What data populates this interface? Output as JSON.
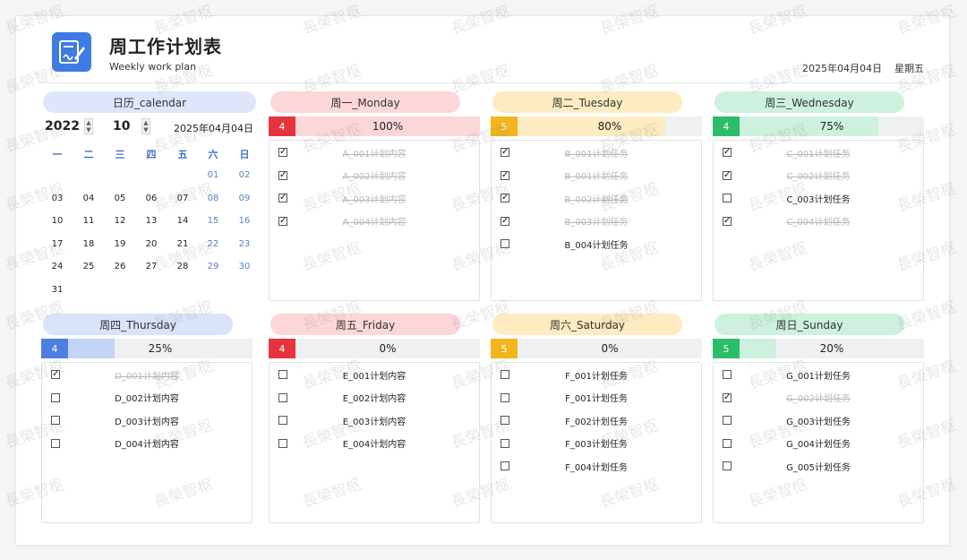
{
  "header": {
    "title": "周工作计划表",
    "subtitle": "Weekly work plan",
    "date": "2025年04月04日",
    "weekday": "星期五"
  },
  "calendar": {
    "title": "日历_calendar",
    "year": "2022",
    "month": "10",
    "date": "2025年04月04日",
    "weekdays": [
      "一",
      "二",
      "三",
      "四",
      "五",
      "六",
      "日"
    ],
    "rows": [
      [
        "",
        "",
        "",
        "",
        "",
        "01",
        "02"
      ],
      [
        "03",
        "04",
        "05",
        "06",
        "07",
        "08",
        "09"
      ],
      [
        "10",
        "11",
        "12",
        "13",
        "14",
        "15",
        "16"
      ],
      [
        "17",
        "18",
        "19",
        "20",
        "21",
        "22",
        "23"
      ],
      [
        "24",
        "25",
        "26",
        "27",
        "28",
        "29",
        "30"
      ],
      [
        "31",
        "",
        "",
        "",
        "",
        "",
        ""
      ]
    ]
  },
  "days": [
    {
      "title": "周一_Monday",
      "count": "4",
      "percent": "100%",
      "fraction": 1.0,
      "pill": "#fcd7d9",
      "num": "#e6343e",
      "fill": "#fcd7d9",
      "tasks": [
        {
          "text": "A_001计划内容",
          "done": true
        },
        {
          "text": "A_002计划内容",
          "done": true
        },
        {
          "text": "A_003计划内容",
          "done": true
        },
        {
          "text": "A_004计划内容",
          "done": true
        }
      ]
    },
    {
      "title": "周二_Tuesday",
      "count": "5",
      "percent": "80%",
      "fraction": 0.8,
      "pill": "#fdebc2",
      "num": "#f2b51d",
      "fill": "#fdebc2",
      "tasks": [
        {
          "text": "B_001计划任务",
          "done": true
        },
        {
          "text": "B_001计划任务",
          "done": true
        },
        {
          "text": "B_002计划任务",
          "done": true
        },
        {
          "text": "B_003计划任务",
          "done": true
        },
        {
          "text": "B_004计划任务",
          "done": false
        }
      ]
    },
    {
      "title": "周三_Wednesday",
      "count": "4",
      "percent": "75%",
      "fraction": 0.75,
      "pill": "#cdf1de",
      "num": "#2bbd6a",
      "fill": "#cdf1de",
      "tasks": [
        {
          "text": "C_001计划任务",
          "done": true
        },
        {
          "text": "C_002计划任务",
          "done": true
        },
        {
          "text": "C_003计划任务",
          "done": false
        },
        {
          "text": "C_004计划任务",
          "done": true
        }
      ]
    },
    {
      "title": "周四_Thursday",
      "count": "4",
      "percent": "25%",
      "fraction": 0.25,
      "pill": "#d9e3fa",
      "num": "#4e7fe0",
      "fill": "#c4d4f7",
      "tasks": [
        {
          "text": "D_001计划内容",
          "done": true
        },
        {
          "text": "D_002计划内容",
          "done": false
        },
        {
          "text": "D_003计划内容",
          "done": false
        },
        {
          "text": "D_004计划内容",
          "done": false
        }
      ]
    },
    {
      "title": "周五_Friday",
      "count": "4",
      "percent": "0%",
      "fraction": 0.0,
      "pill": "#fcd7d9",
      "num": "#e6343e",
      "fill": "#fcd7d9",
      "tasks": [
        {
          "text": "E_001计划内容",
          "done": false
        },
        {
          "text": "E_002计划内容",
          "done": false
        },
        {
          "text": "E_003计划内容",
          "done": false
        },
        {
          "text": "E_004计划内容",
          "done": false
        }
      ]
    },
    {
      "title": "周六_Saturday",
      "count": "5",
      "percent": "0%",
      "fraction": 0.0,
      "pill": "#fdebc2",
      "num": "#f2b51d",
      "fill": "#fdebc2",
      "tasks": [
        {
          "text": "F_001计划任务",
          "done": false
        },
        {
          "text": "F_001计划任务",
          "done": false
        },
        {
          "text": "F_002计划任务",
          "done": false
        },
        {
          "text": "F_003计划任务",
          "done": false
        },
        {
          "text": "F_004计划任务",
          "done": false
        }
      ]
    },
    {
      "title": "周日_Sunday",
      "count": "5",
      "percent": "20%",
      "fraction": 0.2,
      "pill": "#cdf1de",
      "num": "#2bbd6a",
      "fill": "#cdf1de",
      "tasks": [
        {
          "text": "G_001计划任务",
          "done": false
        },
        {
          "text": "G_002计划任务",
          "done": true
        },
        {
          "text": "G_003计划任务",
          "done": false
        },
        {
          "text": "G_004计划任务",
          "done": false
        },
        {
          "text": "G_005计划任务",
          "done": false
        }
      ]
    }
  ],
  "watermark": "長榮智枢"
}
